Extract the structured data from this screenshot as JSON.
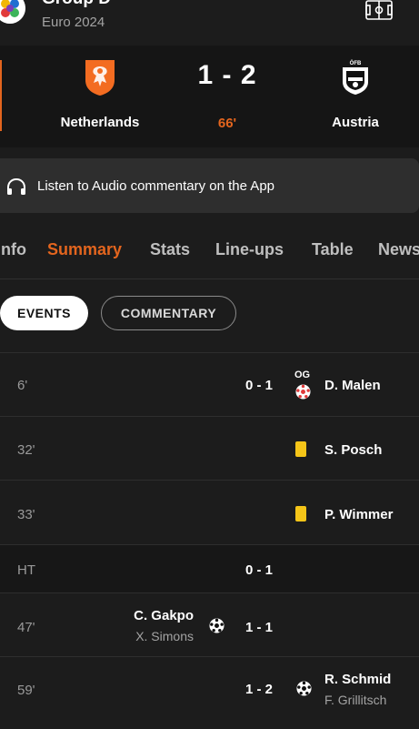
{
  "header": {
    "group_title": "Group D",
    "competition": "Euro 2024"
  },
  "match": {
    "home_team": "Netherlands",
    "away_team": "Austria",
    "score": "1 - 2",
    "minute": "66'"
  },
  "audio": {
    "text": "Listen to Audio commentary on the App"
  },
  "tabs": [
    "Info",
    "Summary",
    "Stats",
    "Line-ups",
    "Table",
    "News"
  ],
  "active_tab": "Summary",
  "toggle": {
    "events_label": "EVENTS",
    "commentary_label": "COMMENTARY"
  },
  "events": [
    {
      "minute": "6'",
      "score": "0 - 1",
      "player": "D. Malen",
      "og_label": "OG",
      "type": "own-goal",
      "side": "away"
    },
    {
      "minute": "32'",
      "player": "S. Posch",
      "type": "yellow-card",
      "side": "away"
    },
    {
      "minute": "33'",
      "player": "P. Wimmer",
      "type": "yellow-card",
      "side": "away"
    },
    {
      "minute": "HT",
      "score": "0 - 1",
      "type": "half-time"
    },
    {
      "minute": "47'",
      "score": "1 - 1",
      "player": "C. Gakpo",
      "assist": "X. Simons",
      "type": "goal",
      "side": "home"
    },
    {
      "minute": "59'",
      "score": "1 - 2",
      "player": "R. Schmid",
      "assist": "F. Grillitsch",
      "type": "goal",
      "side": "away"
    }
  ],
  "colors": {
    "accent": "#e3651e",
    "yellow_card": "#f5c518",
    "background": "#1c1c1c"
  }
}
